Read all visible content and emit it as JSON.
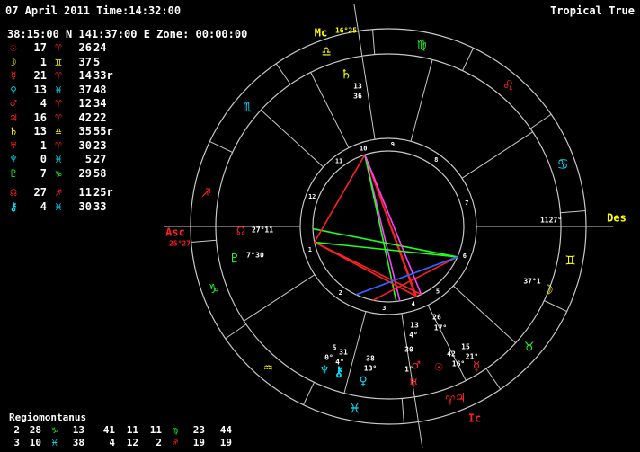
{
  "header": {
    "date_time": "07 April 2011 Time:14:32:00",
    "zodiac": "Tropical True",
    "location": "38:15:00 N 141:37:00 E Zone: 00:00:00"
  },
  "colors": {
    "red": "#ff2020",
    "yellow": "#ffff00",
    "green": "#20ff20",
    "cyan": "#00e5ff",
    "magenta": "#ff40ff",
    "blue": "#3060ff",
    "white": "#ffffff",
    "wheel": "#c8c8c8"
  },
  "planets": [
    {
      "name": "Sun",
      "glyph": "☉",
      "deg": "17",
      "sign": "♈",
      "min": "26",
      "sec": "24",
      "pcolor": "#ff2020",
      "scolor": "#ff2020"
    },
    {
      "name": "Moon",
      "glyph": "☽",
      "deg": "1",
      "sign": "♊",
      "min": "37",
      "sec": "5",
      "pcolor": "#ffff00",
      "scolor": "#ffff00"
    },
    {
      "name": "Mercury",
      "glyph": "☿",
      "deg": "21",
      "sign": "♈",
      "min": "14",
      "sec": "33r",
      "pcolor": "#ff2020",
      "scolor": "#ff2020"
    },
    {
      "name": "Venus",
      "glyph": "♀",
      "deg": "13",
      "sign": "♓",
      "min": "37",
      "sec": "48",
      "pcolor": "#00e5ff",
      "scolor": "#00e5ff"
    },
    {
      "name": "Mars",
      "glyph": "♂",
      "deg": "4",
      "sign": "♈",
      "min": "12",
      "sec": "34",
      "pcolor": "#ff2020",
      "scolor": "#ff2020"
    },
    {
      "name": "Jupiter",
      "glyph": "♃",
      "deg": "16",
      "sign": "♈",
      "min": "42",
      "sec": "22",
      "pcolor": "#ff2020",
      "scolor": "#ff2020"
    },
    {
      "name": "Saturn",
      "glyph": "♄",
      "deg": "13",
      "sign": "♎",
      "min": "35",
      "sec": "55r",
      "pcolor": "#ffff00",
      "scolor": "#ffff00"
    },
    {
      "name": "Uranus",
      "glyph": "♅",
      "deg": "1",
      "sign": "♈",
      "min": "30",
      "sec": "23",
      "pcolor": "#ff2020",
      "scolor": "#ff2020"
    },
    {
      "name": "Neptune",
      "glyph": "♆",
      "deg": "0",
      "sign": "♓",
      "min": "5",
      "sec": "27",
      "pcolor": "#00e5ff",
      "scolor": "#00e5ff"
    },
    {
      "name": "Pluto",
      "glyph": "♇",
      "deg": "7",
      "sign": "♑",
      "min": "29",
      "sec": "58",
      "pcolor": "#20ff20",
      "scolor": "#20ff20"
    },
    {
      "name": "North Node",
      "glyph": "☊",
      "deg": "27",
      "sign": "♐",
      "min": "11",
      "sec": "25r",
      "pcolor": "#ff2020",
      "scolor": "#ff2020"
    },
    {
      "name": "Chiron",
      "glyph": "⚷",
      "deg": "4",
      "sign": "♓",
      "min": "30",
      "sec": "33",
      "pcolor": "#00e5ff",
      "scolor": "#00e5ff"
    }
  ],
  "houses": {
    "system": "Regiomontanus",
    "rows": [
      [
        "2",
        "28",
        "♑",
        "13",
        "41",
        "11",
        "11",
        "♍",
        "23",
        "44"
      ],
      [
        "3",
        "10",
        "♓",
        "38",
        "4",
        "12",
        "2",
        "♐",
        "19",
        "19"
      ]
    ],
    "row_colors": [
      [
        "#ffffff",
        "#ffffff",
        "#20ff20",
        "#ffffff",
        "#ffffff",
        "#ffffff",
        "#ffffff",
        "#20ff20",
        "#ffffff",
        "#ffffff"
      ],
      [
        "#ffffff",
        "#ffffff",
        "#00e5ff",
        "#ffffff",
        "#ffffff",
        "#ffffff",
        "#ffffff",
        "#ff2020",
        "#ffffff",
        "#ffffff"
      ]
    ]
  },
  "wheel": {
    "angles": {
      "mc": "Mc",
      "asc": "Asc",
      "des": "Des",
      "ic": "Ic"
    },
    "mc_degree": "16°25",
    "asc_degree": "25°27",
    "des_degree": "1127°",
    "house_numbers": [
      "1",
      "2",
      "3",
      "4",
      "5",
      "6",
      "7",
      "8",
      "9",
      "10",
      "11",
      "12"
    ],
    "signs": [
      "♑",
      "♒",
      "♓",
      "♈",
      "♉",
      "♊",
      "♋",
      "♌",
      "♍",
      "♎",
      "♏",
      "♐"
    ],
    "planet_labels": [
      {
        "glyph": "♄",
        "text": "13",
        "text2": "36",
        "color": "#ffff00"
      },
      {
        "glyph": "☊",
        "text": "27°11",
        "color": "#ff2020"
      },
      {
        "glyph": "♇",
        "text": "7°",
        "text2": "30",
        "color": "#20ff20"
      },
      {
        "glyph": "☽",
        "text": "37°1",
        "color": "#ffff00"
      },
      {
        "glyph": "♆",
        "text": "5",
        "text2": "0°",
        "color": "#00e5ff"
      },
      {
        "glyph": "⚷",
        "text": "31",
        "text2": "4°",
        "color": "#00e5ff"
      },
      {
        "glyph": "♀",
        "text": "38",
        "text2": "13°",
        "color": "#00e5ff"
      },
      {
        "glyph": "♂",
        "text": "13",
        "text2": "4°",
        "color": "#ff2020"
      },
      {
        "glyph": "♅",
        "text": "30",
        "text2": "1°",
        "color": "#ff2020"
      },
      {
        "glyph": "☉",
        "text": "26",
        "text2": "17°",
        "color": "#ff2020"
      },
      {
        "glyph": "♃",
        "text": "42",
        "text2": "16°",
        "color": "#ff2020"
      },
      {
        "glyph": "☿",
        "text": "15",
        "text2": "21°",
        "color": "#ff2020"
      }
    ]
  }
}
